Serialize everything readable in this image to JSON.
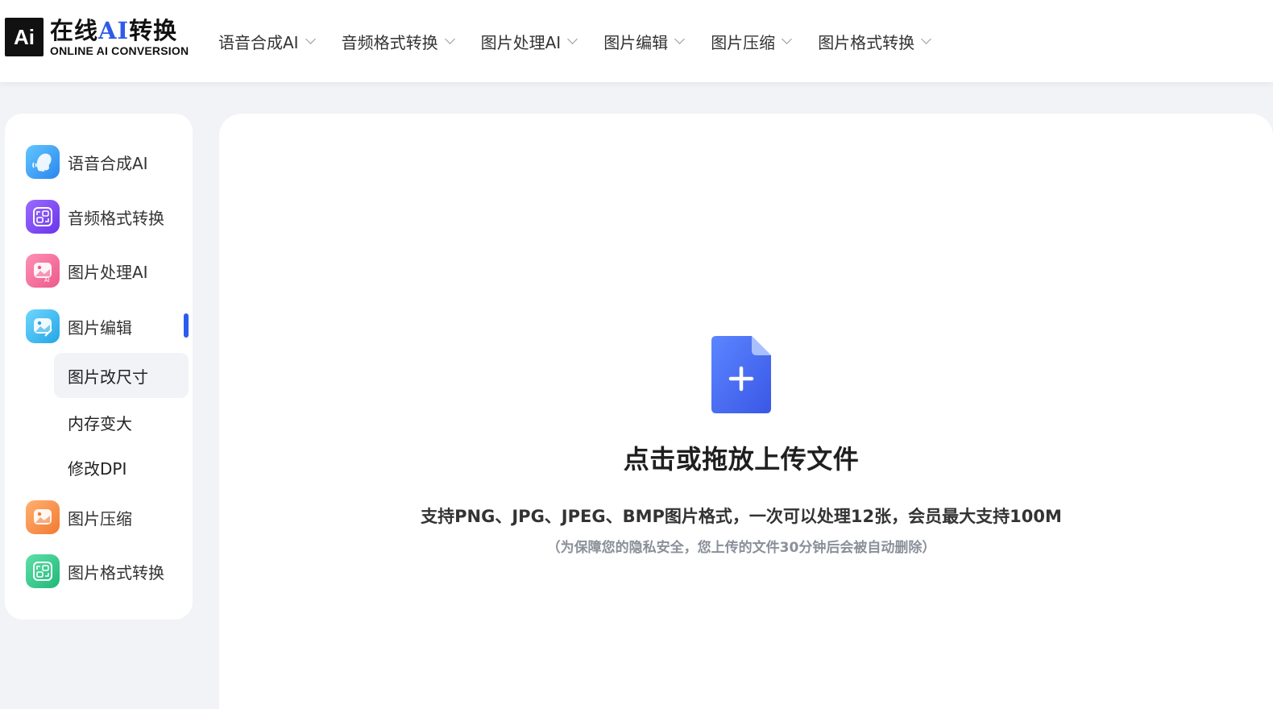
{
  "header": {
    "logo": {
      "mark": "Ai",
      "title_prefix": "在线",
      "title_ai": "AI",
      "title_suffix": "转换",
      "subtitle": "ONLINE AI CONVERSION"
    },
    "nav": [
      {
        "label": "语音合成AI"
      },
      {
        "label": "音频格式转换"
      },
      {
        "label": "图片处理AI"
      },
      {
        "label": "图片编辑"
      },
      {
        "label": "图片压缩"
      },
      {
        "label": "图片格式转换"
      }
    ]
  },
  "sidebar": {
    "items": [
      {
        "label": "语音合成AI",
        "icon": "speech-head-icon",
        "color": "#3aa3f2"
      },
      {
        "label": "音频格式转换",
        "icon": "audio-convert-icon",
        "color": "#7b4df0"
      },
      {
        "label": "图片处理AI",
        "icon": "image-ai-icon",
        "color": "#f06b9a"
      },
      {
        "label": "图片编辑",
        "icon": "image-edit-icon",
        "color": "#36b6f0"
      },
      {
        "label": "图片压缩",
        "icon": "image-compress-icon",
        "color": "#f5904a"
      },
      {
        "label": "图片格式转换",
        "icon": "image-convert-icon",
        "color": "#2ec98a"
      }
    ],
    "active_index": 3,
    "sub_items": [
      {
        "label": "图片改尺寸",
        "active": true
      },
      {
        "label": "内存变大",
        "active": false
      },
      {
        "label": "修改DPI",
        "active": false
      }
    ]
  },
  "main": {
    "upload_title": "点击或拖放上传文件",
    "upload_desc": "支持PNG、JPG、JPEG、BMP图片格式，一次可以处理12张，会员最大支持100M",
    "upload_note": "（为保障您的隐私安全，您上传的文件30分钟后会被自动删除）",
    "accent_color": "#3d63ee"
  }
}
